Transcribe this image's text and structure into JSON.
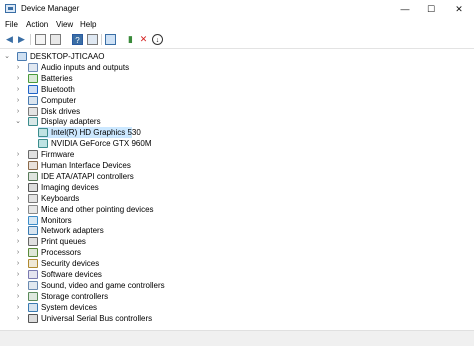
{
  "window": {
    "title": "Device Manager",
    "minimize": "—",
    "maximize": "☐",
    "close": "✕"
  },
  "menu": [
    "File",
    "Action",
    "View",
    "Help"
  ],
  "toolbar": [
    "back",
    "forward",
    "properties",
    "show",
    "help",
    "device",
    "monitor",
    "update",
    "uninstall",
    "download"
  ],
  "tree": {
    "root": "DESKTOP-JTICAAO",
    "categories": [
      {
        "label": "Audio inputs and outputs",
        "icon": "audio-icon",
        "color": "#6b8cb8"
      },
      {
        "label": "Batteries",
        "icon": "battery-icon",
        "color": "#4a9a3a"
      },
      {
        "label": "Bluetooth",
        "icon": "bluetooth-icon",
        "color": "#1e63c8"
      },
      {
        "label": "Computer",
        "icon": "computer-icon",
        "color": "#4a7bb0"
      },
      {
        "label": "Disk drives",
        "icon": "disk-icon",
        "color": "#7a7a7a"
      },
      {
        "label": "Display adapters",
        "icon": "display-adapter-icon",
        "color": "#3c8c8c",
        "expanded": true,
        "children": [
          {
            "label": "Intel(R) HD Graphics 530",
            "selected": true
          },
          {
            "label": "NVIDIA GeForce GTX 960M"
          }
        ]
      },
      {
        "label": "Firmware",
        "icon": "firmware-icon",
        "color": "#6a6a6a"
      },
      {
        "label": "Human Interface Devices",
        "icon": "hid-icon",
        "color": "#8a6a4a"
      },
      {
        "label": "IDE ATA/ATAPI controllers",
        "icon": "ide-icon",
        "color": "#5a7a5a"
      },
      {
        "label": "Imaging devices",
        "icon": "camera-icon",
        "color": "#555555"
      },
      {
        "label": "Keyboards",
        "icon": "keyboard-icon",
        "color": "#777777"
      },
      {
        "label": "Mice and other pointing devices",
        "icon": "mouse-icon",
        "color": "#888888"
      },
      {
        "label": "Monitors",
        "icon": "monitor-icon",
        "color": "#3c8cc8"
      },
      {
        "label": "Network adapters",
        "icon": "network-icon",
        "color": "#3a7ab0"
      },
      {
        "label": "Print queues",
        "icon": "printer-icon",
        "color": "#666666"
      },
      {
        "label": "Processors",
        "icon": "processor-icon",
        "color": "#5a8a3a"
      },
      {
        "label": "Security devices",
        "icon": "security-icon",
        "color": "#b08a30"
      },
      {
        "label": "Software devices",
        "icon": "software-icon",
        "color": "#7a7ab0"
      },
      {
        "label": "Sound, video and game controllers",
        "icon": "sound-icon",
        "color": "#6a8ab0"
      },
      {
        "label": "Storage controllers",
        "icon": "storage-icon",
        "color": "#5a8a5a"
      },
      {
        "label": "System devices",
        "icon": "system-icon",
        "color": "#3a7ab0"
      },
      {
        "label": "Universal Serial Bus controllers",
        "icon": "usb-icon",
        "color": "#555555"
      }
    ]
  }
}
